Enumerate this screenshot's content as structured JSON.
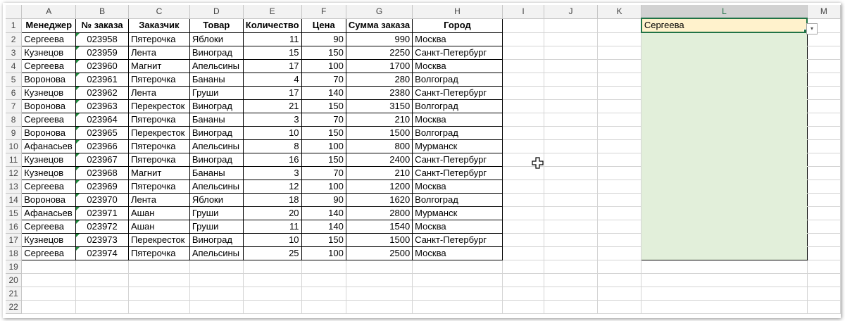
{
  "columns": [
    "A",
    "B",
    "C",
    "D",
    "E",
    "F",
    "G",
    "H",
    "I",
    "J",
    "K",
    "L",
    "M"
  ],
  "selected_column": "L",
  "row_numbers": [
    "1",
    "2",
    "3",
    "4",
    "5",
    "6",
    "7",
    "8",
    "9",
    "10",
    "11",
    "12",
    "13",
    "14",
    "15",
    "16",
    "17",
    "18",
    "19",
    "20",
    "21",
    "22"
  ],
  "table": {
    "headers": [
      "Менеджер",
      "№ заказа",
      "Заказчик",
      "Товар",
      "Количество",
      "Цена",
      "Сумма заказа",
      "Город"
    ],
    "rows": [
      [
        "Сергеева",
        "023958",
        "Пятерочка",
        "Яблоки",
        "11",
        "90",
        "990",
        "Москва"
      ],
      [
        "Кузнецов",
        "023959",
        "Лента",
        "Виноград",
        "15",
        "150",
        "2250",
        "Санкт-Петербург"
      ],
      [
        "Сергеева",
        "023960",
        "Магнит",
        "Апельсины",
        "17",
        "100",
        "1700",
        "Москва"
      ],
      [
        "Воронова",
        "023961",
        "Пятерочка",
        "Бананы",
        "4",
        "70",
        "280",
        "Волгоград"
      ],
      [
        "Кузнецов",
        "023962",
        "Лента",
        "Груши",
        "17",
        "140",
        "2380",
        "Санкт-Петербург"
      ],
      [
        "Воронова",
        "023963",
        "Перекресток",
        "Виноград",
        "21",
        "150",
        "3150",
        "Волгоград"
      ],
      [
        "Сергеева",
        "023964",
        "Пятерочка",
        "Бананы",
        "3",
        "70",
        "210",
        "Москва"
      ],
      [
        "Воронова",
        "023965",
        "Перекресток",
        "Виноград",
        "10",
        "150",
        "1500",
        "Волгоград"
      ],
      [
        "Афанасьев",
        "023966",
        "Пятерочка",
        "Апельсины",
        "8",
        "100",
        "800",
        "Мурманск"
      ],
      [
        "Кузнецов",
        "023967",
        "Пятерочка",
        "Виноград",
        "16",
        "150",
        "2400",
        "Санкт-Петербург"
      ],
      [
        "Кузнецов",
        "023968",
        "Магнит",
        "Бананы",
        "3",
        "70",
        "210",
        "Санкт-Петербург"
      ],
      [
        "Сергеева",
        "023969",
        "Пятерочка",
        "Апельсины",
        "12",
        "100",
        "1200",
        "Москва"
      ],
      [
        "Воронова",
        "023970",
        "Лента",
        "Яблоки",
        "18",
        "90",
        "1620",
        "Волгоград"
      ],
      [
        "Афанасьев",
        "023971",
        "Ашан",
        "Груши",
        "20",
        "140",
        "2800",
        "Мурманск"
      ],
      [
        "Сергеева",
        "023972",
        "Ашан",
        "Груши",
        "11",
        "140",
        "1540",
        "Москва"
      ],
      [
        "Кузнецов",
        "023973",
        "Перекресток",
        "Виноград",
        "10",
        "150",
        "1500",
        "Санкт-Петербург"
      ],
      [
        "Сергеева",
        "023974",
        "Пятерочка",
        "Апельсины",
        "25",
        "100",
        "2500",
        "Москва"
      ]
    ]
  },
  "active_cell": {
    "ref": "L1",
    "value": "Сергеева"
  },
  "dropdown_arrow": "▾",
  "colors": {
    "excel_green": "#217346",
    "active_cell_fill": "#fff2cc",
    "range_fill": "#e2efda",
    "header_fill": "#f2f2f2"
  },
  "icons": [
    "dropdown-arrow-icon",
    "plus-cursor-icon",
    "text-number-indicator-icon"
  ]
}
